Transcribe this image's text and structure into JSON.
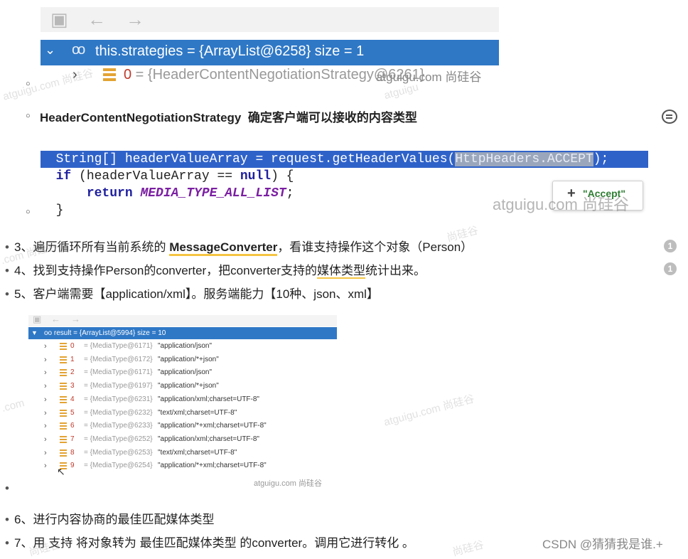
{
  "debugger1": {
    "selected_row": "this.strategies = {ArrayList@6258}  size = 1",
    "child_index": "0",
    "child_rest": " = {HeaderContentNegotiationStrategy@6261}",
    "watermark": "atguigu.com 尚硅谷"
  },
  "heading_item": {
    "strategy_name": "HeaderContentNegotiationStrategy",
    "description": "确定客户端可以接收的内容类型"
  },
  "code": {
    "line1_pre": "String[] headerValueArray = request.getHeaderValues(",
    "line1_hl": "HttpHeaders.ACCEPT",
    "line1_post": ");",
    "line2_kw_if": "if",
    "line2_mid": " (headerValueArray == ",
    "line2_kw_null": "null",
    "line2_post": ") {",
    "line3_kw_return": "return",
    "line3_const": "MEDIA_TYPE_ALL_LIST",
    "line3_post": ";",
    "line4": "}",
    "tooltip_label": "\"Accept\"",
    "watermark": "atguigu.com 尚硅谷"
  },
  "steps": {
    "s3_pre": "3、遍历循环所有当前系统的 ",
    "s3_bold": "MessageConverter",
    "s3_post": "，看谁支持操作这个对象（Person）",
    "s3_badge": "1",
    "s4_pre": "4、找到支持操作Person的converter，把converter支持的",
    "s4_ul": "媒体类型",
    "s4_post": "统计出来。",
    "s4_badge": "1",
    "s5": "5、客户端需要【application/xml】。服务端能力【10种、json、xml】",
    "s6": "6、进行内容协商的最佳匹配媒体类型",
    "s7": "7、用 支持 将对象转为 最佳匹配媒体类型 的converter。调用它进行转化 。"
  },
  "debugger2": {
    "selected_row": "result = {ArrayList@5994}  size = 10",
    "rows": [
      {
        "idx": "0",
        "typ": " = {MediaType@6171}",
        "val": "\"application/json\""
      },
      {
        "idx": "1",
        "typ": " = {MediaType@6172}",
        "val": "\"application/*+json\""
      },
      {
        "idx": "2",
        "typ": " = {MediaType@6171}",
        "val": "\"application/json\""
      },
      {
        "idx": "3",
        "typ": " = {MediaType@6197}",
        "val": "\"application/*+json\""
      },
      {
        "idx": "4",
        "typ": " = {MediaType@6231}",
        "val": "\"application/xml;charset=UTF-8\""
      },
      {
        "idx": "5",
        "typ": " = {MediaType@6232}",
        "val": "\"text/xml;charset=UTF-8\""
      },
      {
        "idx": "6",
        "typ": " = {MediaType@6233}",
        "val": "\"application/*+xml;charset=UTF-8\""
      },
      {
        "idx": "7",
        "typ": " = {MediaType@6252}",
        "val": "\"application/xml;charset=UTF-8\""
      },
      {
        "idx": "8",
        "typ": " = {MediaType@6253}",
        "val": "\"text/xml;charset=UTF-8\""
      },
      {
        "idx": "9",
        "typ": " = {MediaType@6254}",
        "val": "\"application/*+xml;charset=UTF-8\""
      }
    ],
    "watermark": "atguigu.com 尚硅谷"
  },
  "footer": "CSDN @猜猜我是谁.+",
  "faint_watermarks": [
    "atguigu.com 尚硅谷",
    "atguigu",
    "尚硅谷",
    "atguigu.com 尚硅谷",
    ".com",
    ".com 尚硅谷",
    "尚硅谷",
    "尚硅谷"
  ]
}
